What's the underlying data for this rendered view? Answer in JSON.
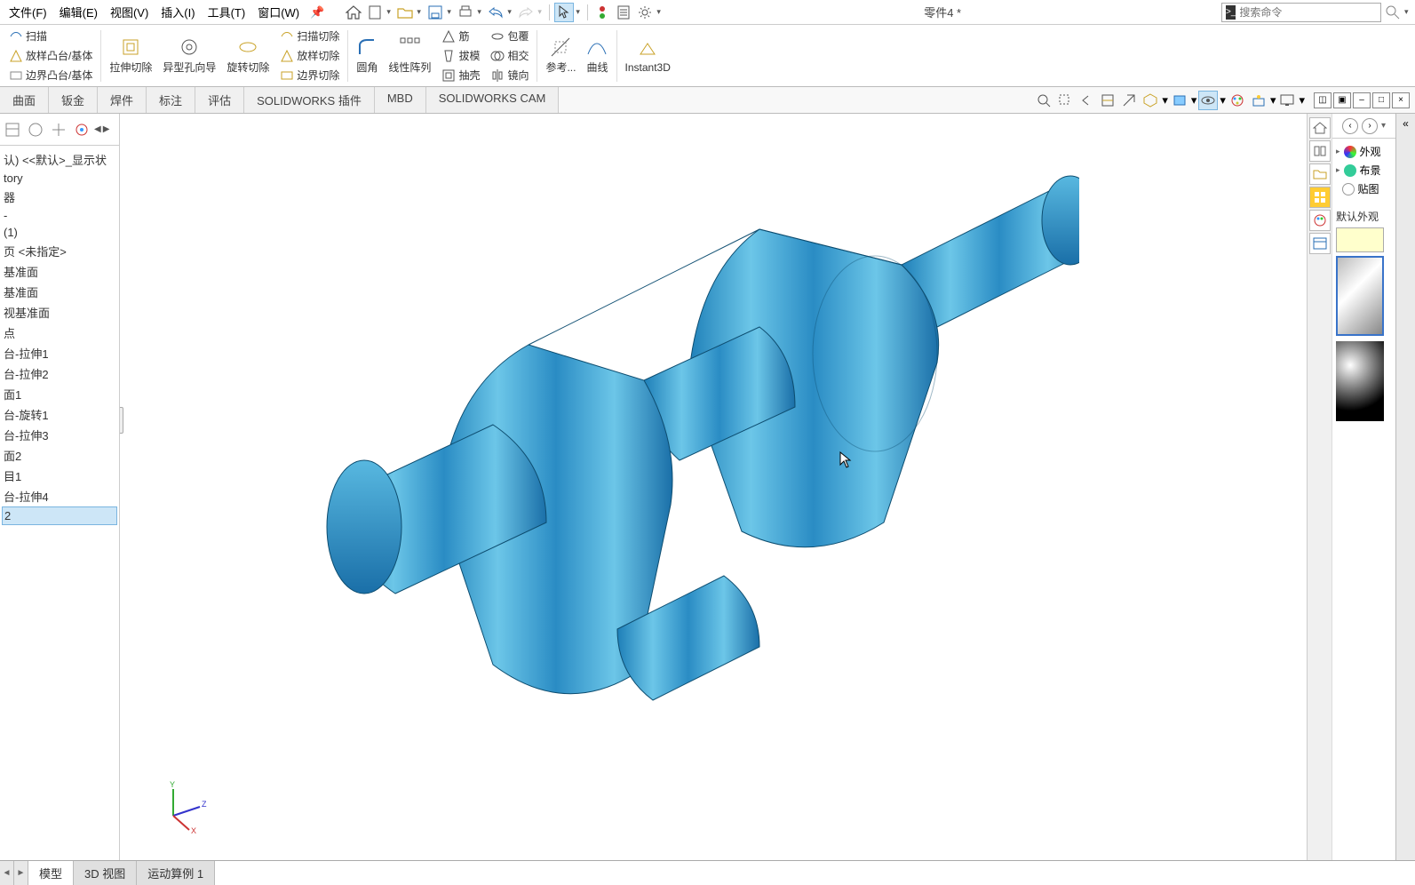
{
  "menu": {
    "file": "文件(F)",
    "edit": "编辑(E)",
    "view": "视图(V)",
    "insert": "插入(I)",
    "tools": "工具(T)",
    "window": "窗口(W)"
  },
  "doc_title": "零件4 *",
  "search_placeholder": "搜索命令",
  "ribbon": {
    "scan": "扫描",
    "loft": "放样凸台/基体",
    "boundary": "边界凸台/基体",
    "extcut": "拉伸切除",
    "holewiz": "异型孔向导",
    "revcut": "旋转切除",
    "scancut": "扫描切除",
    "loftcut": "放样切除",
    "bndcut": "边界切除",
    "fillet": "圆角",
    "linpat": "线性阵列",
    "rib": "筋",
    "draft": "拔模",
    "shell": "抽壳",
    "wrap": "包覆",
    "intersect": "相交",
    "mirror": "镜向",
    "refgeom": "参考...",
    "curves": "曲线",
    "instant3d": "Instant3D"
  },
  "tabs": {
    "surf": "曲面",
    "sheet": "钣金",
    "weld": "焊件",
    "annot": "标注",
    "eval": "评估",
    "swaddin": "SOLIDWORKS 插件",
    "mbd": "MBD",
    "swcam": "SOLIDWORKS CAM"
  },
  "tree": {
    "header": "认) <<默认>_显示状",
    "items": [
      "tory",
      "器",
      "-",
      "(1)",
      "页 <未指定>",
      "基准面",
      "基准面",
      "视基准面",
      "点",
      "台-拉伸1",
      "台-拉伸2",
      "面1",
      "台-旋转1",
      "台-拉伸3",
      "面2",
      "目1",
      "台-拉伸4",
      "2"
    ],
    "selected_index": 17
  },
  "rpanel": {
    "appearance_root": "外观",
    "layout_root": "布景",
    "decal_root": "贴图",
    "default_appearance": "默认外观"
  },
  "bottom": {
    "model": "模型",
    "view3d": "3D 视图",
    "motion": "运动算例 1"
  }
}
